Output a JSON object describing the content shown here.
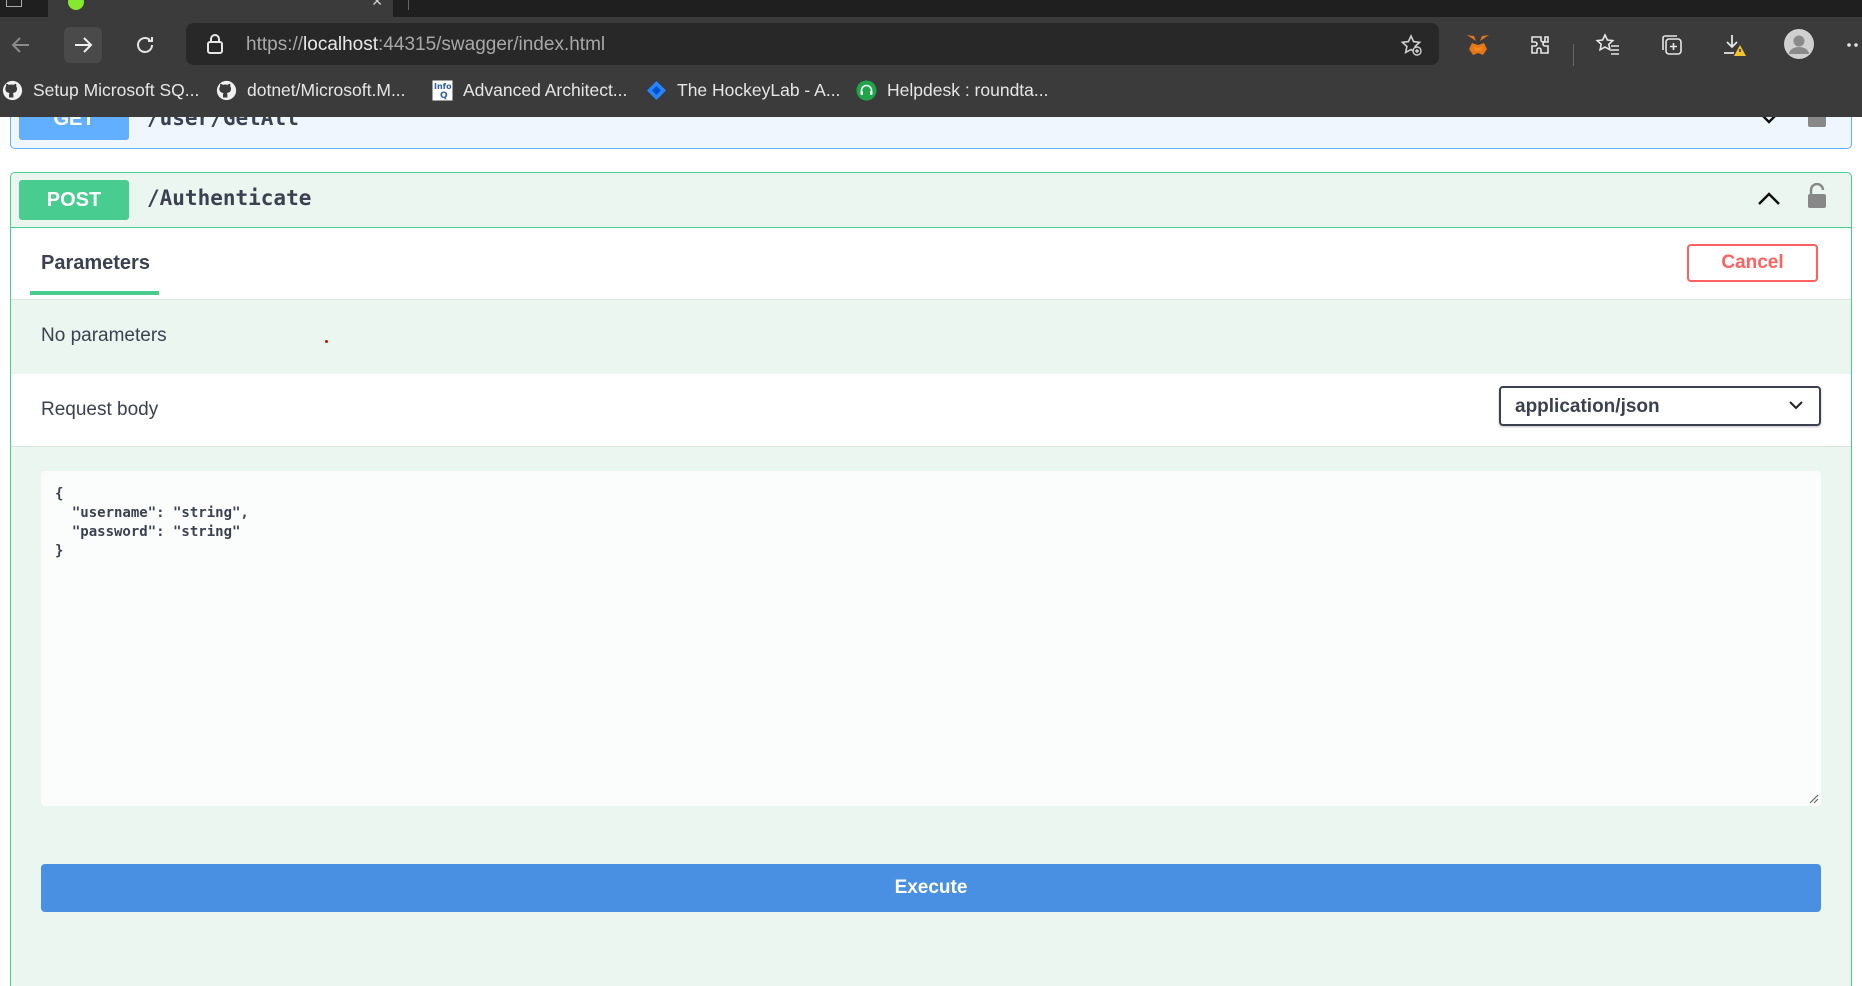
{
  "browser": {
    "url_scheme": "https://",
    "url_host": "localhost",
    "url_rest": ":44315/swagger/index.html",
    "bookmarks": [
      {
        "label": "Setup Microsoft SQ...",
        "icon": "github-icon"
      },
      {
        "label": "dotnet/Microsoft.M...",
        "icon": "github-icon"
      },
      {
        "label": "Advanced Architect...",
        "icon": "infoq-icon"
      },
      {
        "label": "The HockeyLab - A...",
        "icon": "jira-icon"
      },
      {
        "label": "Helpdesk : roundta...",
        "icon": "headset-icon"
      }
    ]
  },
  "swagger": {
    "get_op": {
      "method": "GET",
      "path": "/user/GetAll"
    },
    "post_op": {
      "method": "POST",
      "path": "/Authenticate"
    },
    "parameters_tab": "Parameters",
    "cancel_label": "Cancel",
    "no_parameters": "No parameters",
    "request_body_label": "Request body",
    "content_type": "application/json",
    "body_json": "{\n  \"username\": \"string\",\n  \"password\": \"string\"\n}",
    "execute_label": "Execute"
  },
  "colors": {
    "get": "#61affe",
    "post": "#49cc90",
    "cancel": "#ff6060",
    "execute": "#4990e2",
    "chrome": "#3b3b3b"
  }
}
